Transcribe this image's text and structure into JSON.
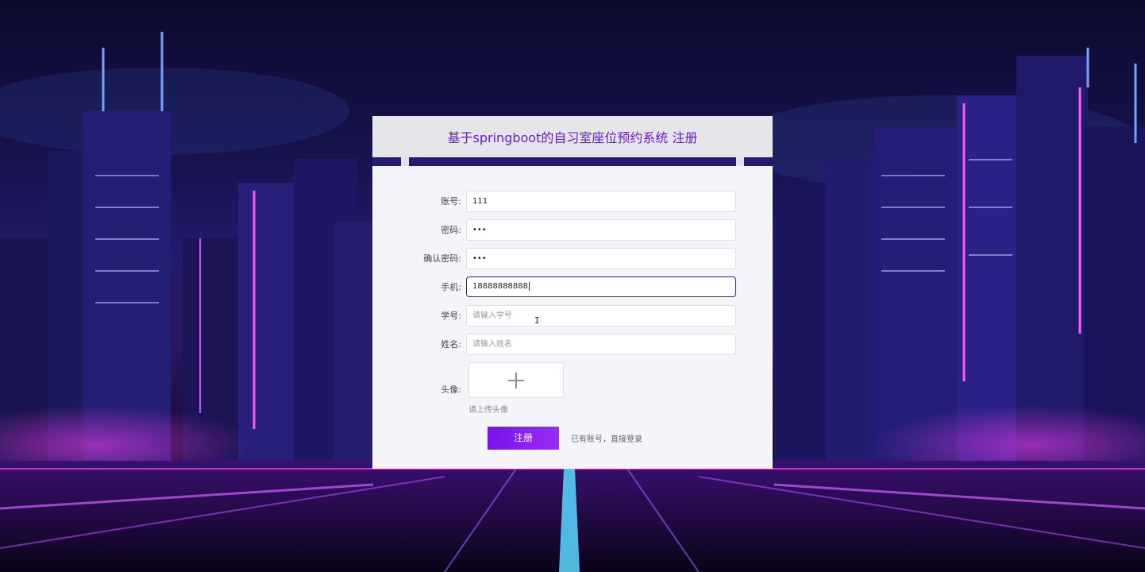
{
  "page": {
    "title": "基于springboot的自习室座位预约系统 注册"
  },
  "form": {
    "account": {
      "label": "账号:",
      "value": "111",
      "placeholder": ""
    },
    "password": {
      "label": "密码:",
      "value": "•••",
      "placeholder": ""
    },
    "confirm_password": {
      "label": "确认密码:",
      "value": "•••",
      "placeholder": ""
    },
    "phone": {
      "label": "手机:",
      "value": "18888888888",
      "placeholder": ""
    },
    "student_id": {
      "label": "学号:",
      "value": "",
      "placeholder": "请输入学号"
    },
    "name": {
      "label": "姓名:",
      "value": "",
      "placeholder": "请输入姓名"
    },
    "avatar": {
      "label": "头像:",
      "tip": "请上传头像",
      "icon": "plus-icon"
    }
  },
  "actions": {
    "register_label": "注册",
    "login_link": "已有账号，直接登录"
  },
  "colors": {
    "accent": "#7a12ee",
    "title": "#6a19d8",
    "focus_border": "#2a2a9a"
  }
}
